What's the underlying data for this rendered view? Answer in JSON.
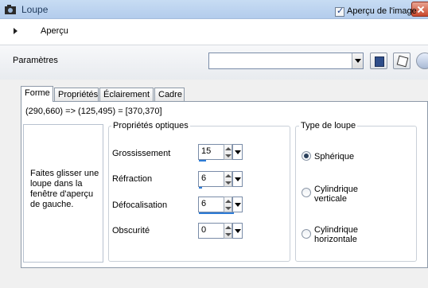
{
  "window": {
    "title": "Loupe",
    "close_icon": "close-icon",
    "app_icon": "camera-icon"
  },
  "preview": {
    "section_label": "Aperçu",
    "image_preview_label": "Aperçu de l'image",
    "image_preview_checked": true
  },
  "params": {
    "label": "Paramètres",
    "combo_value": "",
    "buttons": [
      "save-preset-icon",
      "randomize-dice-icon",
      "reset-icon"
    ]
  },
  "tabs": [
    "Forme",
    "Propriétés",
    "Éclairement",
    "Cadre"
  ],
  "active_tab": "Forme",
  "coords": "(290,660) => (125,495) = [370,370]",
  "instructions": "Faites glisser une loupe dans la fenêtre d'aperçu de gauche.",
  "optics": {
    "legend": "Propriétés optiques",
    "fields": [
      {
        "label": "Grossissement",
        "value": "15"
      },
      {
        "label": "Réfraction",
        "value": "6"
      },
      {
        "label": "Défocalisation",
        "value": "6"
      },
      {
        "label": "Obscurité",
        "value": "0"
      }
    ]
  },
  "loupe_type": {
    "legend": "Type de loupe",
    "options": [
      {
        "label": "Sphérique",
        "selected": true
      },
      {
        "label": "Cylindrique verticale",
        "selected": false
      },
      {
        "label": "Cylindrique horizontale",
        "selected": false
      }
    ]
  },
  "colors": {
    "titlebar": "#c7dcf3",
    "accent_bar": "#2d7bd6",
    "close_button": "#c9482c"
  }
}
